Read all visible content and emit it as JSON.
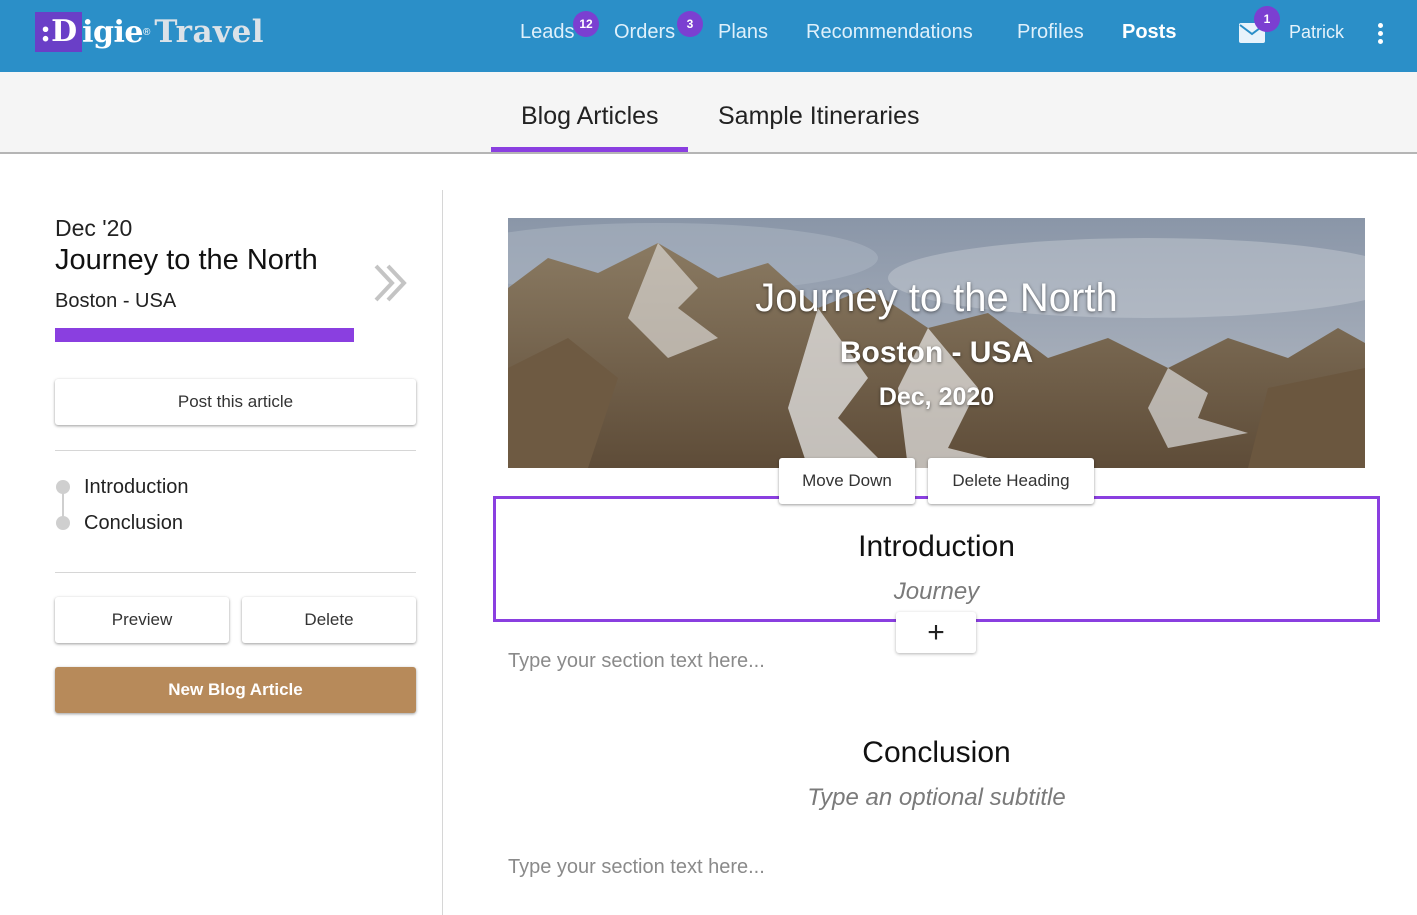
{
  "app": {
    "logo_prefix": ":D",
    "logo_rest": "igie",
    "logo_reg": "®",
    "logo_travel": "Travel"
  },
  "nav": {
    "items": [
      {
        "label": "Leads",
        "badge": "12"
      },
      {
        "label": "Orders",
        "badge": "3"
      },
      {
        "label": "Plans"
      },
      {
        "label": "Recommendations"
      },
      {
        "label": "Profiles"
      },
      {
        "label": "Posts",
        "active": true
      }
    ],
    "mail_badge": "1",
    "user_name": "Patrick"
  },
  "subtabs": {
    "items": [
      {
        "label": "Blog Articles",
        "active": true
      },
      {
        "label": "Sample Itineraries"
      }
    ]
  },
  "sidebar": {
    "date": "Dec '20",
    "title": "Journey to the North",
    "location": "Boston - USA",
    "post_button": "Post this article",
    "toc": [
      "Introduction",
      "Conclusion"
    ],
    "preview_button": "Preview",
    "delete_button": "Delete",
    "new_button": "New Blog Article"
  },
  "hero": {
    "title": "Journey to the North",
    "location": "Boston - USA",
    "date": "Dec, 2020"
  },
  "section_toolbar": {
    "move_down": "Move Down",
    "delete_heading": "Delete Heading"
  },
  "sections": [
    {
      "heading": "Introduction",
      "subtitle": "Journey",
      "text_placeholder": "Type your section text here..."
    },
    {
      "heading": "Conclusion",
      "subtitle": "Type an optional subtitle",
      "text_placeholder": "Type your section text here..."
    }
  ],
  "add_section_label": "+",
  "colors": {
    "topbar": "#2b8fc8",
    "accent": "#8a3fe0",
    "badge": "#7b3fd1",
    "brown_button": "#b78a5a"
  }
}
